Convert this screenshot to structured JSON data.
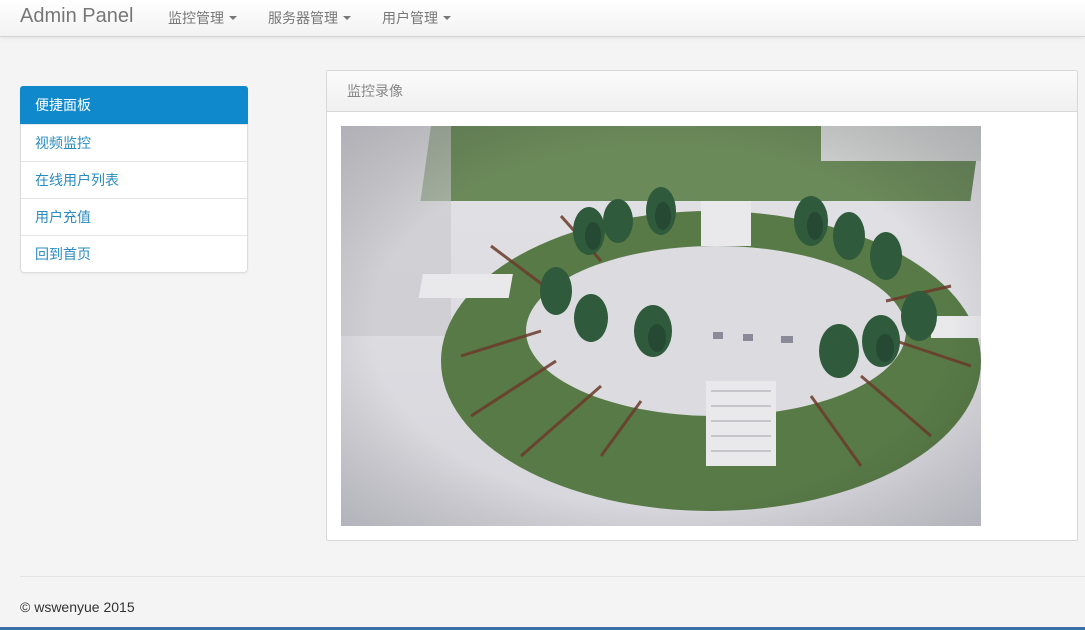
{
  "navbar": {
    "brand": "Admin Panel",
    "menus": [
      {
        "label": "监控管理"
      },
      {
        "label": "服务器管理"
      },
      {
        "label": "用户管理"
      }
    ]
  },
  "sidebar": {
    "items": [
      {
        "label": "便捷面板",
        "active": true
      },
      {
        "label": "视频监控"
      },
      {
        "label": "在线用户列表"
      },
      {
        "label": "用户充值"
      },
      {
        "label": "回到首页"
      }
    ]
  },
  "panel": {
    "title": "监控录像",
    "video_description": "camera-feed-of-oval-garden-model"
  },
  "footer": {
    "text": "© wswenyue 2015"
  },
  "colors": {
    "accent": "#0f88cc",
    "link": "#2a8bc2",
    "grass": "#4e6b3c",
    "tree": "#2f5a3c"
  }
}
